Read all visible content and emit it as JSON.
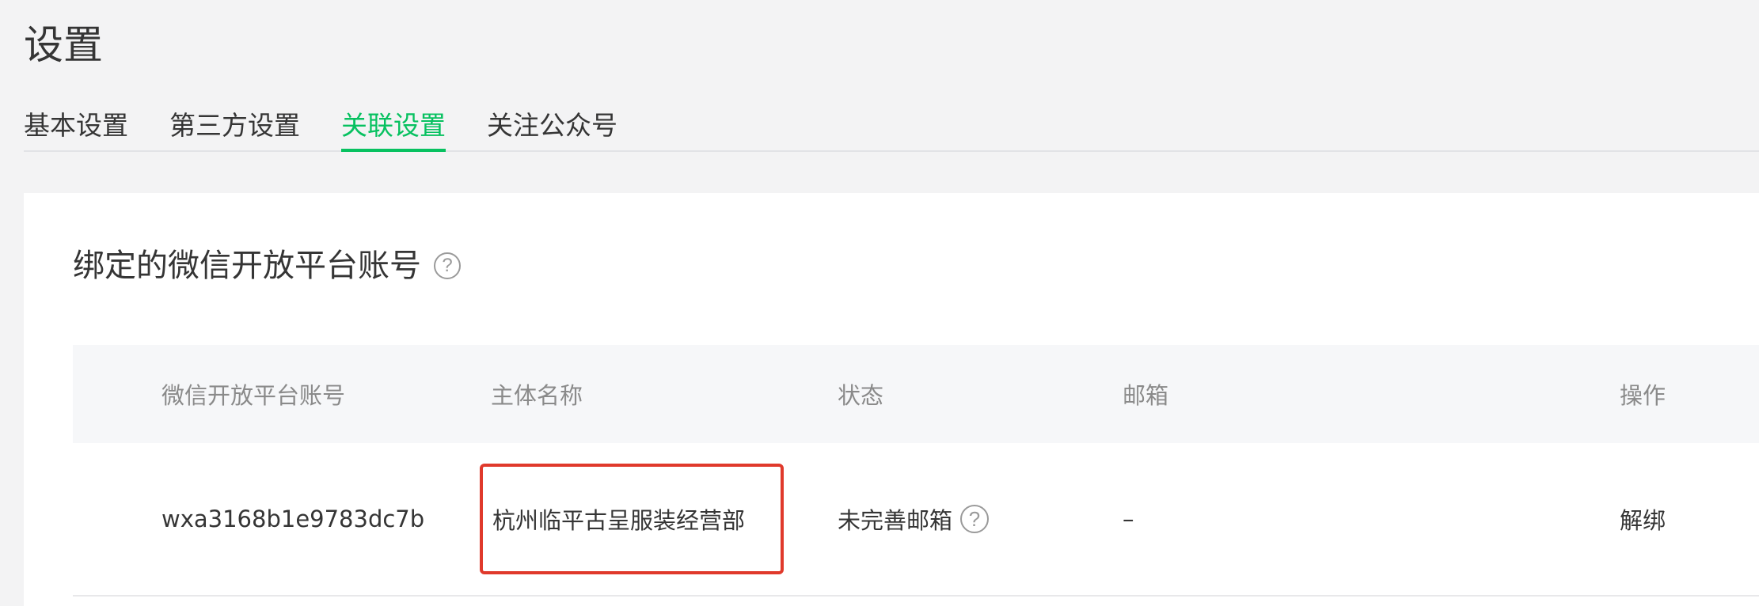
{
  "page": {
    "title": "设置"
  },
  "tabs": [
    {
      "label": "基本设置",
      "active": false
    },
    {
      "label": "第三方设置",
      "active": false
    },
    {
      "label": "关联设置",
      "active": true
    },
    {
      "label": "关注公众号",
      "active": false
    }
  ],
  "section": {
    "title": "绑定的微信开放平台账号",
    "help_icon": "question-circle-icon"
  },
  "table": {
    "headers": [
      "微信开放平台账号",
      "主体名称",
      "状态",
      "邮箱",
      "操作"
    ],
    "rows": [
      {
        "account": "wxa3168b1e9783dc7b",
        "entity_name": "杭州临平古呈服装经营部",
        "status": "未完善邮箱",
        "email": "–",
        "action": "解绑"
      }
    ]
  },
  "colors": {
    "accent": "#07c160",
    "link": "#576b95",
    "highlight": "#e0392b"
  }
}
